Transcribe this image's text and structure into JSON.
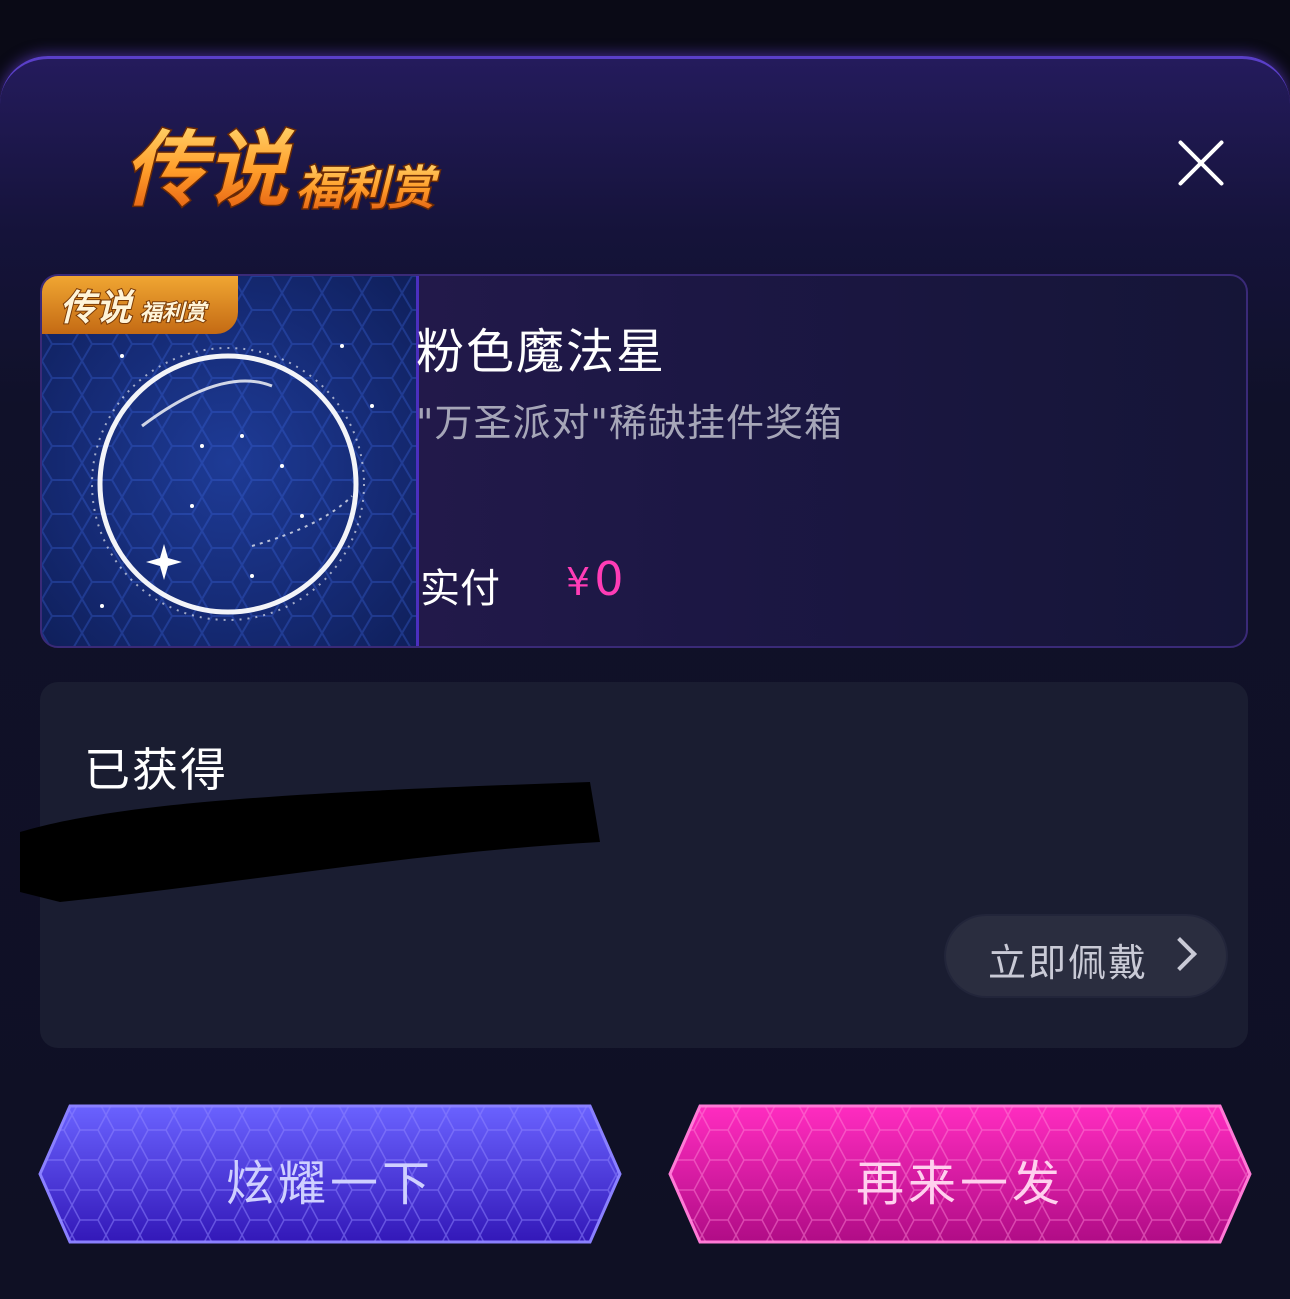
{
  "header": {
    "logo_text": "传说福利赏",
    "close_icon": "close-icon"
  },
  "item": {
    "badge_text": "传说福利赏",
    "name": "粉色魔法星",
    "source": "\"万圣派对\"稀缺挂件奖箱",
    "pay_label": "实付",
    "currency": "¥",
    "amount": "0"
  },
  "obtained": {
    "title": "已获得",
    "wear_label": "立即佩戴"
  },
  "actions": {
    "show_label": "炫耀一下",
    "again_label": "再来一发"
  },
  "colors": {
    "accent_pink": "#ff3cb6",
    "button_blue": "#4a3ae0",
    "button_pink": "#e0169e"
  }
}
